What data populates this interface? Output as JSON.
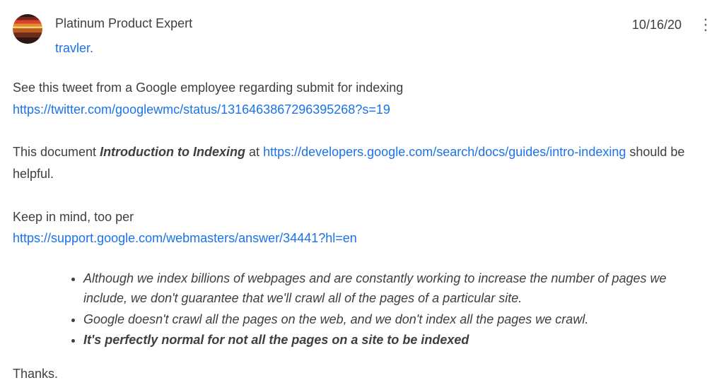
{
  "post": {
    "role": "Platinum Product Expert",
    "username": "travler.",
    "date": "10/16/20",
    "body": {
      "intro_text": "See this tweet from a Google employee regarding submit for indexing",
      "tweet_url": "https://twitter.com/googlewmc/status/1316463867296395268?s=19",
      "doc_prefix": "This document  ",
      "doc_title_bold": "Introduction to Indexing",
      "doc_at": " at  ",
      "doc_url": "https://developers.google.com/search/docs/guides/intro-indexing",
      "doc_suffix": " should be helpful.",
      "keep_in_mind": "Keep in mind, too per",
      "support_url": "https://support.google.com/webmasters/answer/34441?hl=en",
      "bullets": [
        "Although we index billions of webpages and are constantly working to increase the number of pages we include, we don't guarantee that we'll crawl all of the pages of a particular site.",
        "Google doesn't crawl all the pages on the web, and we don't index all the pages we crawl.",
        "It's perfectly normal for not all the pages on a site to be indexed"
      ],
      "thanks": "Thanks."
    }
  }
}
